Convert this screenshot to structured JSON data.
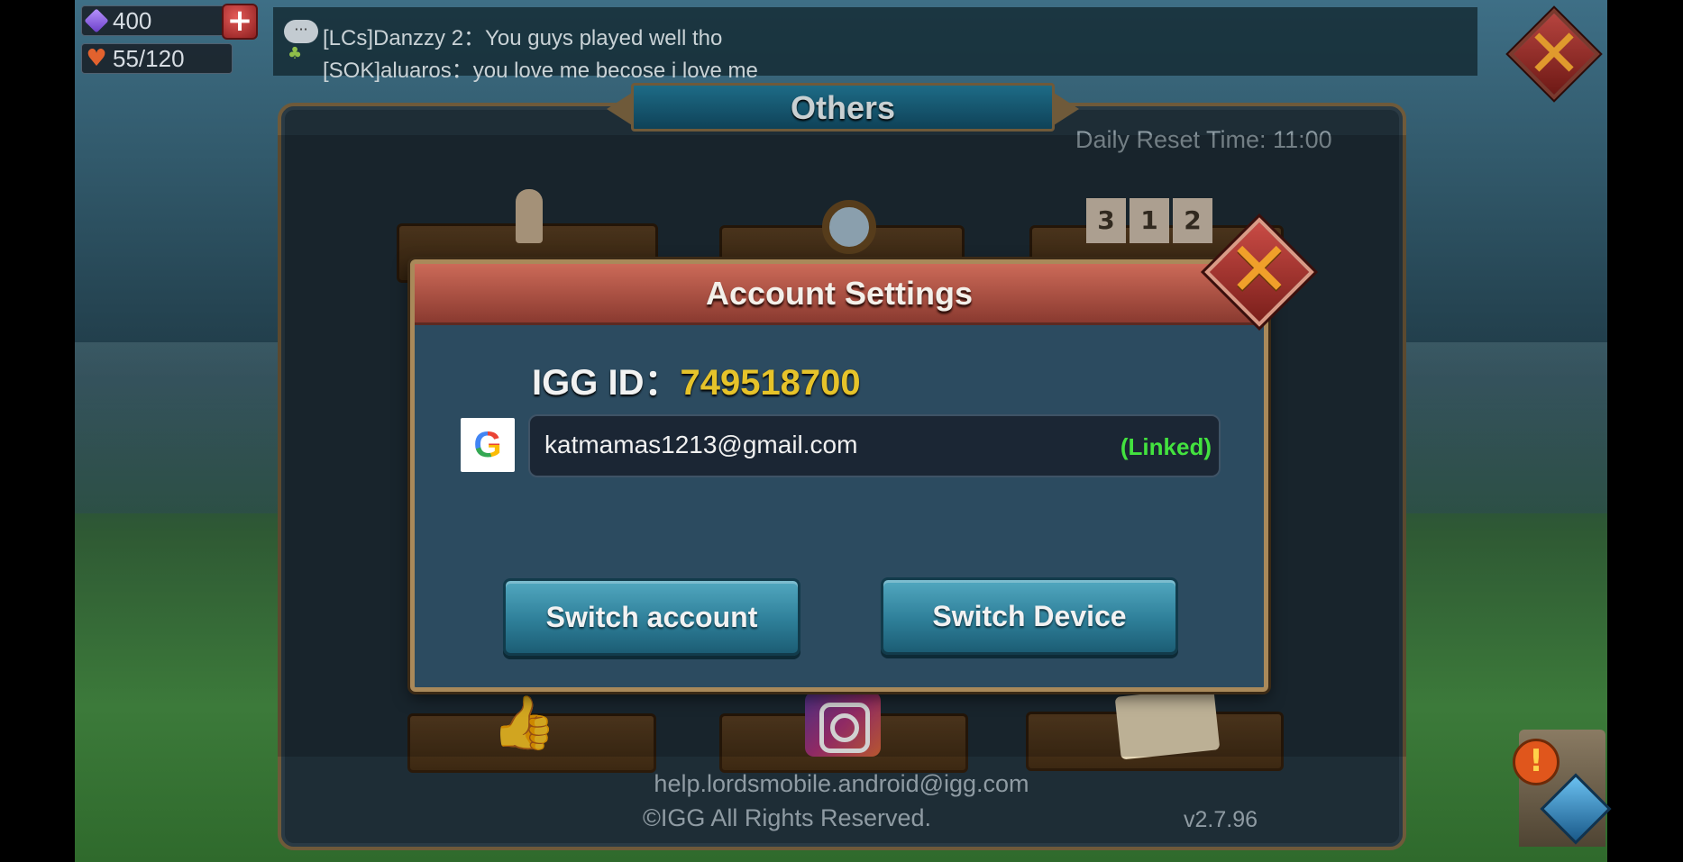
{
  "resources": {
    "gems": "400",
    "stamina": "55/120"
  },
  "chat": {
    "lines": [
      "[LCs]Danzzy 2：You guys played well tho",
      "[SOK]aluaros：you love me becose i love me"
    ]
  },
  "others_panel": {
    "title": "Others",
    "daily_reset": "Daily Reset Time: 11:00",
    "support_email": "help.lordsmobile.android@igg.com",
    "copyright": "©IGG All Rights Reserved.",
    "version": "v2.7.96"
  },
  "account_settings": {
    "title": "Account Settings",
    "igg_id_label": "IGG ID：",
    "igg_id_value": "749518700",
    "linked_account": {
      "provider_icon": "google-icon",
      "email": "katmamas1213@gmail.com",
      "status": "(Linked)"
    },
    "buttons": {
      "switch_account": "Switch account",
      "switch_device": "Switch Device"
    }
  },
  "icons": {
    "close": "close-icon",
    "plus": "plus-icon",
    "chat": "chat-icon"
  },
  "colors": {
    "id_value": "#e6c32a",
    "linked_status": "#43e23f",
    "header_red": "#cc6a58",
    "button_teal": "#2e7f99"
  }
}
